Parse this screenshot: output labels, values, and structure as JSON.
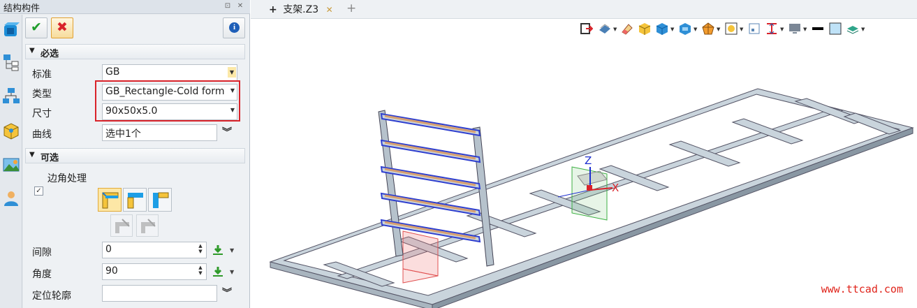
{
  "panel": {
    "title": "结构构件",
    "pin_glyph": "⊡",
    "close_glyph": "✕"
  },
  "buttons": {
    "ok": "✔",
    "cancel": "✖",
    "info": "i"
  },
  "required": {
    "header": "必选",
    "rows": [
      {
        "label": "标准",
        "value": "GB"
      },
      {
        "label": "类型",
        "value": "GB_Rectangle-Cold form"
      },
      {
        "label": "尺寸",
        "value": "90x50x5.0"
      },
      {
        "label": "曲线",
        "value": "选中1个"
      }
    ]
  },
  "optional": {
    "header": "可选",
    "corner_label": "边角处理",
    "corner_checked": true,
    "gap_label": "间隙",
    "gap_value": "0",
    "angle_label": "角度",
    "angle_value": "90",
    "profile_label": "定位轮廓",
    "profile_value": ""
  },
  "document": {
    "tab_title": "支架.Z3",
    "tab_plus": "+",
    "tab_close": "✕",
    "new_tab": "+"
  },
  "viewport": {
    "axis_x": "X",
    "axis_z": "Z",
    "watermark": "www.ttcad.com"
  },
  "colors": {
    "highlight": "#d9232a",
    "frame": "#c9d4dc",
    "rail": "#2f3fcf",
    "accent_rail": "#d7a070",
    "watermark": "#e0241b"
  },
  "icons": [
    "cube-icon",
    "tree-icon",
    "hierarchy-icon",
    "part-icon",
    "image-icon",
    "user-icon",
    "view-orient-icon",
    "eraser-icon",
    "shade-icon",
    "box-icon",
    "render-icon",
    "section-icon",
    "zoom-fit-icon",
    "frame-icon",
    "dimension-icon",
    "display-icon",
    "line-color-icon",
    "fill-color-icon",
    "layer-icon"
  ]
}
